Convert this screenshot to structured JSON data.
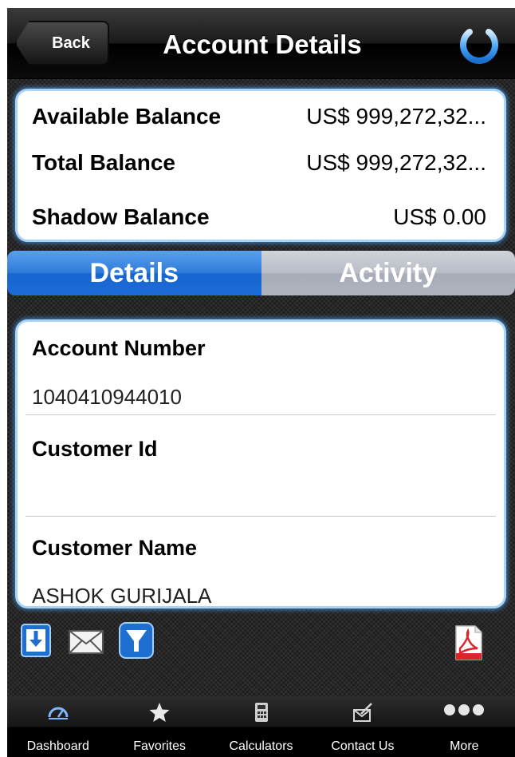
{
  "header": {
    "back_label": "Back",
    "title": "Account Details"
  },
  "balances": [
    {
      "label": "Available Balance",
      "value": "US$ 999,272,32..."
    },
    {
      "label": "Total Balance",
      "value": "US$ 999,272,32..."
    },
    {
      "label": "Shadow Balance",
      "value": "US$ 0.00"
    }
  ],
  "segments": {
    "details": "Details",
    "activity": "Activity",
    "selected": "Details"
  },
  "details": {
    "account_number_label": "Account Number",
    "account_number": "1040410944010",
    "customer_id_label": "Customer Id",
    "customer_id": "",
    "customer_name_label": "Customer Name",
    "customer_name": "ASHOK GURIJALA"
  },
  "actions": [
    "download-icon",
    "mail-icon",
    "filter-icon",
    "pdf-icon"
  ],
  "tabbar": [
    {
      "label": "Dashboard",
      "icon": "dashboard-icon"
    },
    {
      "label": "Favorites",
      "icon": "star-icon"
    },
    {
      "label": "Calculators",
      "icon": "calculator-icon"
    },
    {
      "label": "Contact Us",
      "icon": "contact-icon"
    },
    {
      "label": "More",
      "icon": "more-icon"
    }
  ],
  "colors": {
    "accent_blue": "#1c6bd6",
    "card_glow": "#4696e6",
    "pdf_red": "#d8262b"
  }
}
